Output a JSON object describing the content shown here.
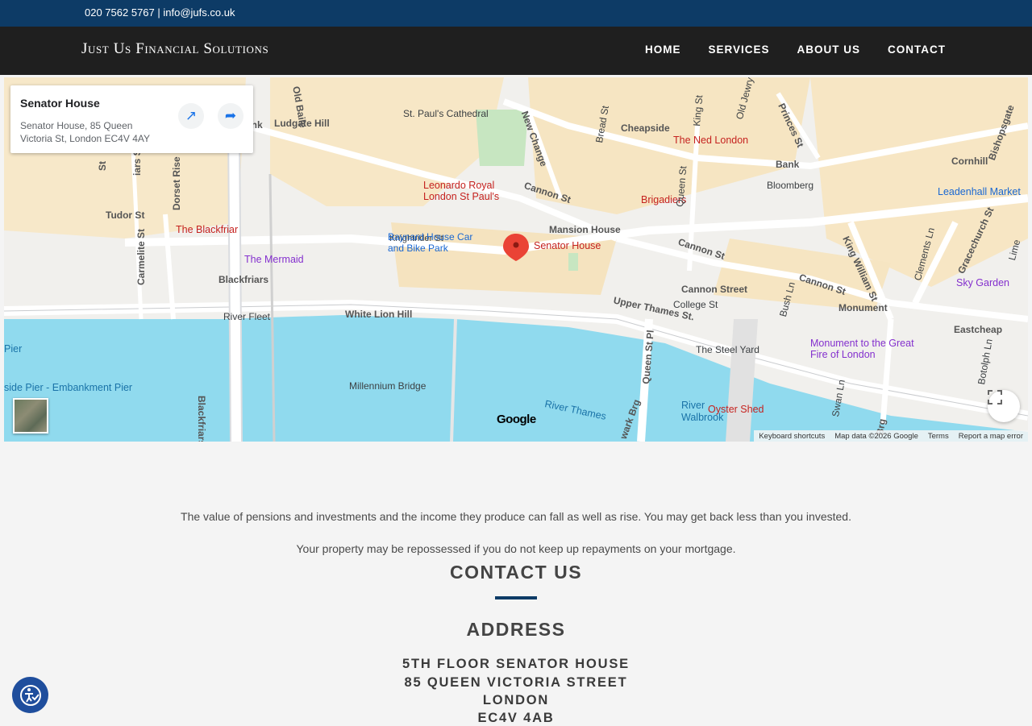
{
  "topbar": {
    "phone": "020 7562 5767",
    "separator": " | ",
    "email": "info@jufs.co.uk"
  },
  "header": {
    "logo": "Just Us Financial Solutions",
    "nav": [
      "HOME",
      "SERVICES",
      "ABOUT US",
      "CONTACT"
    ]
  },
  "map": {
    "card": {
      "title": "Senator House",
      "address": "Senator House, 85 Queen Victoria St, London EC4V 4AY"
    },
    "marker_label": "Senator House",
    "labels": {
      "stpauls": "St. Paul's Cathedral",
      "ludgate": "Ludgate Hill",
      "cheapside": "Cheapside",
      "nedlondon": "The Ned London",
      "bank": "Bank",
      "bloomberg": "Bloomberg",
      "cornhill": "Cornhill",
      "leadenhall": "Leadenhall Market",
      "leonardo": "Leonardo Royal London St Paul's",
      "cannonst1": "Cannon St",
      "brigadiers": "Brigadiers",
      "tudor": "Tudor St",
      "blackfriar": "The Blackfriar",
      "knightrider": "Knightrider St",
      "baynard": "Baynard House Car and Bike Park",
      "mansionhouse": "Mansion House",
      "mermaid": "The Mermaid",
      "blackfriars": "Blackfriars",
      "cannonst2": "Cannon St",
      "cannonstation": "Cannon Street",
      "collegest": "College St",
      "cannonst3": "Cannon St",
      "monument": "Monument",
      "skygarden": "Sky Garden",
      "riverfleet": "River Fleet",
      "whitelion": "White Lion Hill",
      "upperthames": "Upper Thames St.",
      "eastcheap": "Eastcheap",
      "steelyard": "The Steel Yard",
      "monumentfire": "Monument to the Great Fire of London",
      "blackfriarsbridge": "Blackfriars Bridge",
      "millennium": "Millennium Bridge",
      "riverthames": "River Thames",
      "walbrook": "River Walbrook",
      "oystershed": "Oyster Shed",
      "embankment": "side Pier - Embankment Pier",
      "pier": "Pier",
      "kingwilliam": "King William St",
      "gracechurch": "Gracechurch St",
      "queenst": "Queen St",
      "queenstpl": "Queen St Pl",
      "dorset": "Dorset Rise",
      "carmelite": "Carmelite St",
      "newchange": "New Change",
      "breadst": "Bread St",
      "princes": "Princes St",
      "bishopsgate": "Bishopsgate",
      "kingst": "King St",
      "oldjewry": "Old Jewry",
      "oldbaile": "Old Baile",
      "bushln": "Bush Ln",
      "swanln": "Swan Ln",
      "botolphln": "Botolph Ln",
      "clementsln": "Clements Ln",
      "lime": "Lime",
      "southwark": "wark Brg",
      "brg": "Brg",
      "ank": "ank",
      "st": "St",
      "iars": "iars St"
    },
    "attribution": [
      "Keyboard shortcuts",
      "Map data ©2026 Google",
      "Terms",
      "Report a map error"
    ],
    "google": "Google"
  },
  "disclaimers": [
    "The value of pensions and investments and the income they produce can fall as well as rise. You may get back less than you invested.",
    "Your property may be repossessed if you do not keep up repayments on your mortgage."
  ],
  "contact": {
    "heading": "CONTACT US",
    "address_heading": "ADDRESS",
    "address_lines": [
      "5TH FLOOR SENATOR HOUSE",
      "85 QUEEN VICTORIA STREET",
      "LONDON",
      "EC4V 4AB"
    ]
  },
  "colors": {
    "topbar": "#0d3b66",
    "navbar": "#1f1f1f",
    "accent": "#0d3b66",
    "water": "#90daee"
  }
}
